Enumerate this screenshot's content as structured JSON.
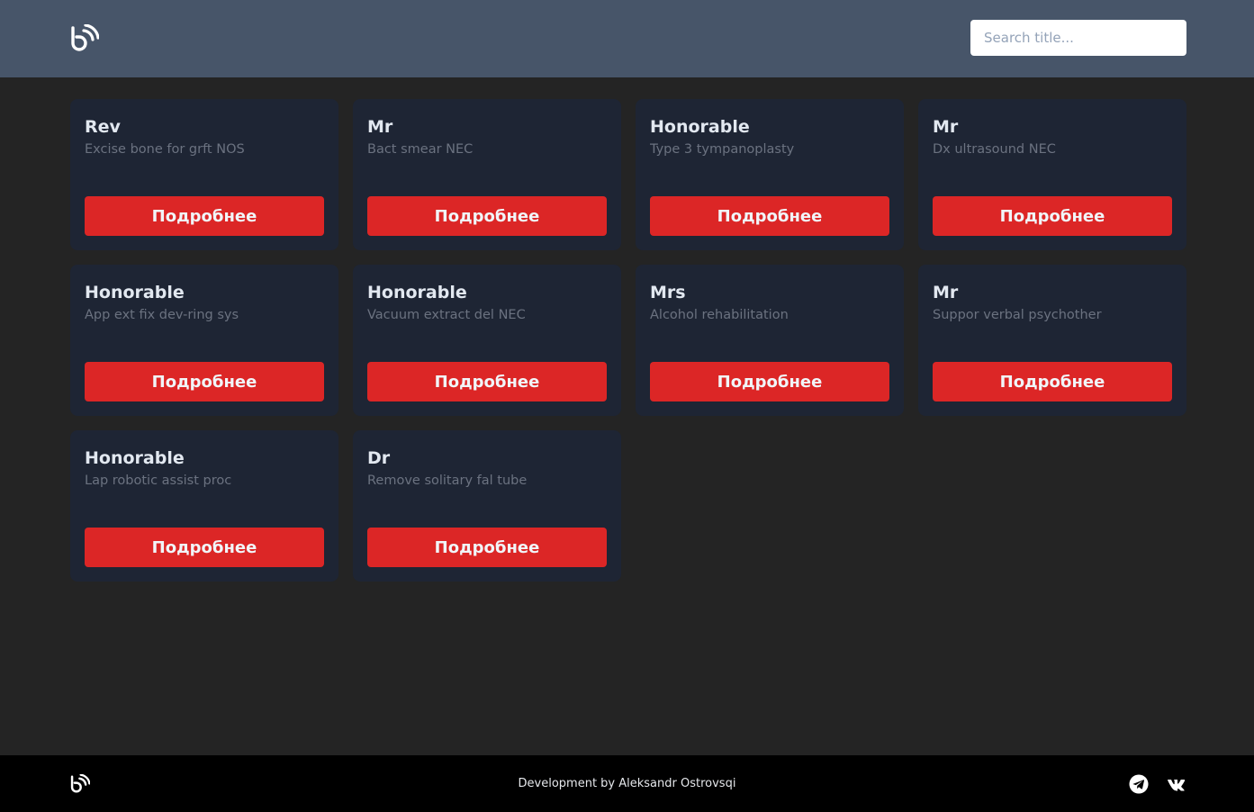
{
  "header": {
    "search_placeholder": "Search title..."
  },
  "cards": [
    {
      "title": "Rev",
      "subtitle": "Excise bone for grft NOS",
      "button": "Подробнее"
    },
    {
      "title": "Mr",
      "subtitle": "Bact smear NEC",
      "button": "Подробнее"
    },
    {
      "title": "Honorable",
      "subtitle": "Type 3 tympanoplasty",
      "button": "Подробнее"
    },
    {
      "title": "Mr",
      "subtitle": "Dx ultrasound NEC",
      "button": "Подробнее"
    },
    {
      "title": "Honorable",
      "subtitle": "App ext fix dev-ring sys",
      "button": "Подробнее"
    },
    {
      "title": "Honorable",
      "subtitle": "Vacuum extract del NEC",
      "button": "Подробнее"
    },
    {
      "title": "Mrs",
      "subtitle": "Alcohol rehabilitation",
      "button": "Подробнее"
    },
    {
      "title": "Mr",
      "subtitle": "Suppor verbal psychother",
      "button": "Подробнее"
    },
    {
      "title": "Honorable",
      "subtitle": "Lap robotic assist proc",
      "button": "Подробнее"
    },
    {
      "title": "Dr",
      "subtitle": "Remove solitary fal tube",
      "button": "Подробнее"
    }
  ],
  "footer": {
    "credit": "Development by Aleksandr Ostrovsqi",
    "social_icons": [
      "telegram-icon",
      "vk-icon"
    ]
  },
  "colors": {
    "header_bg": "#475569",
    "page_bg": "#242424",
    "card_bg": "#1e2534",
    "accent": "#dc2626",
    "footer_bg": "#000000"
  }
}
